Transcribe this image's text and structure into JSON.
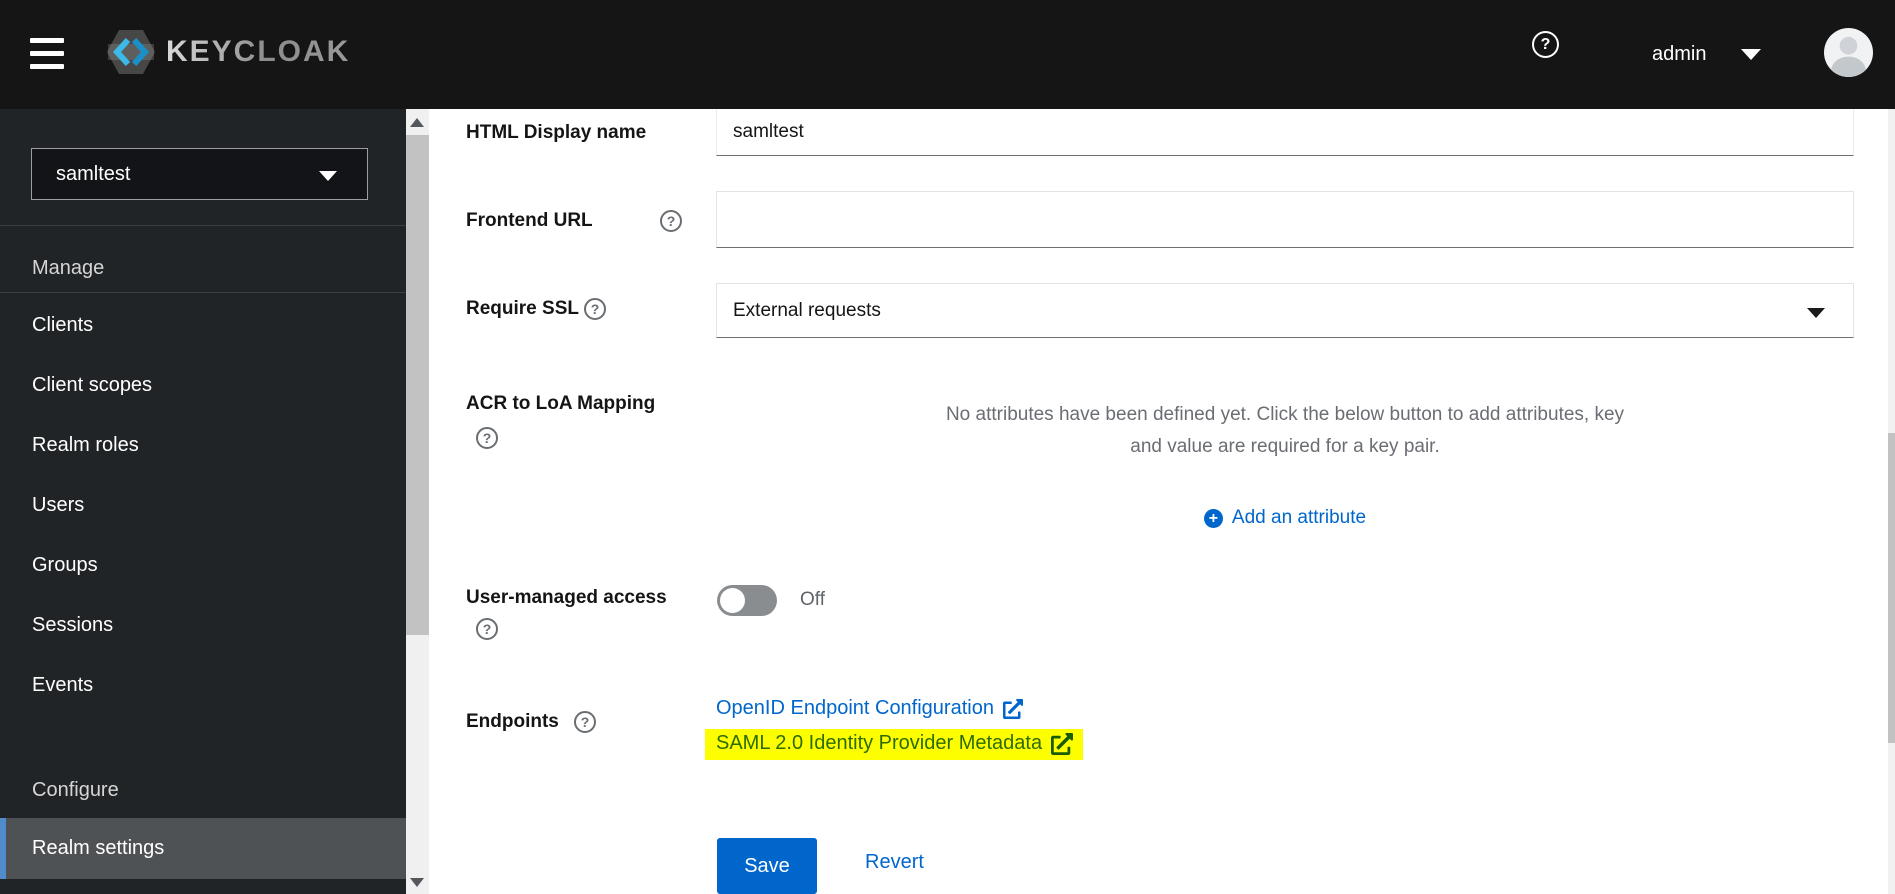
{
  "header": {
    "brand": "KEYCLOAK",
    "username": "admin"
  },
  "sidebar": {
    "realm_selector": {
      "value": "samltest"
    },
    "sections": [
      {
        "title": "Manage",
        "items": [
          "Clients",
          "Client scopes",
          "Realm roles",
          "Users",
          "Groups",
          "Sessions",
          "Events"
        ]
      },
      {
        "title": "Configure",
        "items": [
          "Realm settings"
        ]
      }
    ],
    "selected_item": "Realm settings"
  },
  "form": {
    "html_display_name": {
      "label": "HTML Display name",
      "value": "samltest"
    },
    "frontend_url": {
      "label": "Frontend URL",
      "value": ""
    },
    "require_ssl": {
      "label": "Require SSL",
      "value": "External requests"
    },
    "acr_to_loa_mapping": {
      "label": "ACR to LoA Mapping",
      "empty_text": "No attributes have been defined yet. Click the below button to add attributes, key and value are required for a key pair.",
      "add_button_label": "Add an attribute"
    },
    "user_managed_access": {
      "label": "User-managed access",
      "state": "Off"
    },
    "endpoints": {
      "label": "Endpoints",
      "links": [
        {
          "label": "OpenID Endpoint Configuration",
          "highlighted": false
        },
        {
          "label": "SAML 2.0 Identity Provider Metadata",
          "highlighted": true
        }
      ]
    },
    "actions": {
      "save_label": "Save",
      "revert_label": "Revert"
    }
  },
  "colors": {
    "accent_blue": "#0066cc",
    "highlight_yellow": "#fdff00",
    "highlight_text_green": "#2e6b00",
    "toggle_off_gray": "#8a8d90",
    "header_bg": "#151515",
    "sidebar_bg": "#212427"
  }
}
